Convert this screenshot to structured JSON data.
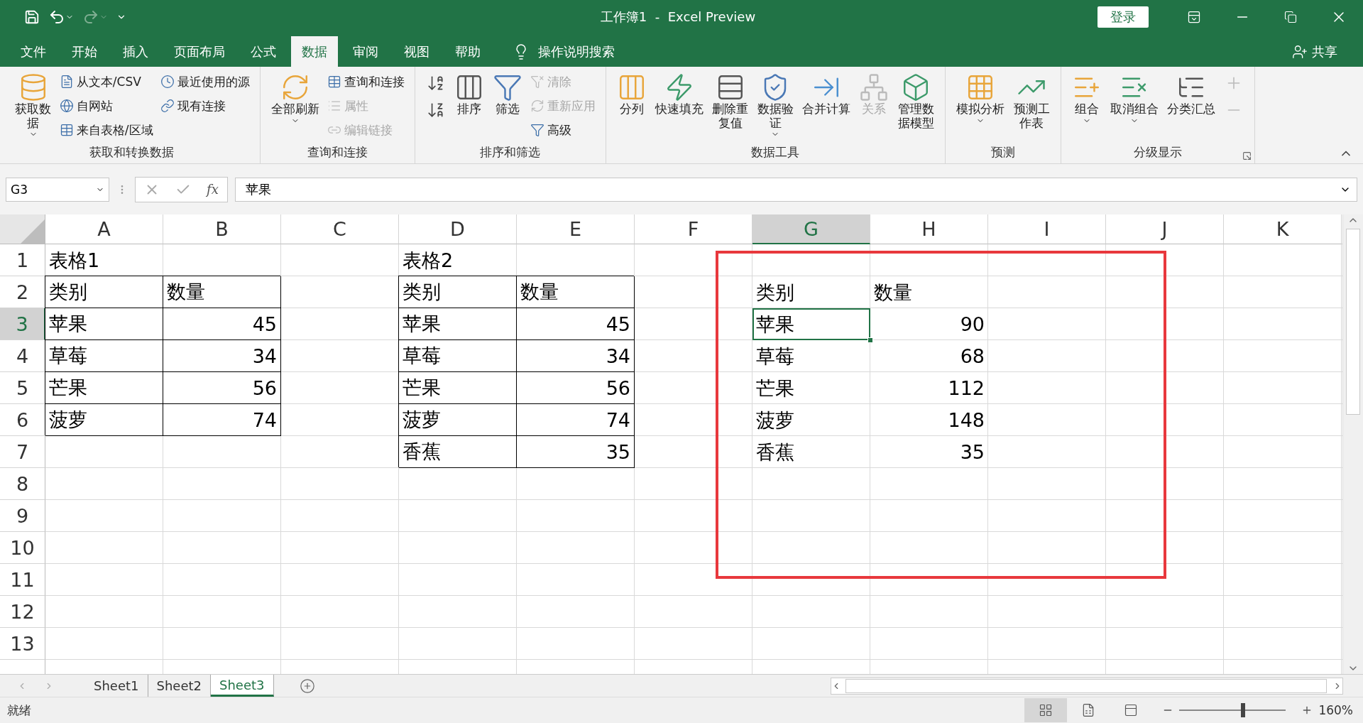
{
  "window": {
    "title": "工作簿1  -  Excel Preview",
    "login": "登录"
  },
  "menu_tabs": [
    {
      "label": "文件",
      "selected": false
    },
    {
      "label": "开始",
      "selected": false
    },
    {
      "label": "插入",
      "selected": false
    },
    {
      "label": "页面布局",
      "selected": false
    },
    {
      "label": "公式",
      "selected": false
    },
    {
      "label": "数据",
      "selected": true
    },
    {
      "label": "审阅",
      "selected": false
    },
    {
      "label": "视图",
      "selected": false
    },
    {
      "label": "帮助",
      "selected": false
    }
  ],
  "tell_me": "操作说明搜索",
  "share": "共享",
  "ribbon": [
    {
      "title": "获取和转换数据",
      "items": [
        {
          "kind": "large",
          "label": "获取数据",
          "dropdown": true,
          "disabled": false
        },
        {
          "kind": "small",
          "label": "从文本/CSV",
          "disabled": false
        },
        {
          "kind": "small",
          "label": "自网站",
          "disabled": false
        },
        {
          "kind": "small",
          "label": "来自表格/区域",
          "disabled": false
        },
        {
          "kind": "small",
          "label": "最近使用的源",
          "disabled": false
        },
        {
          "kind": "small",
          "label": "现有连接",
          "disabled": false
        }
      ]
    },
    {
      "title": "查询和连接",
      "items": [
        {
          "kind": "large",
          "label": "全部刷新",
          "dropdown": true,
          "disabled": false
        },
        {
          "kind": "small",
          "label": "查询和连接",
          "disabled": false
        },
        {
          "kind": "small",
          "label": "属性",
          "disabled": true
        },
        {
          "kind": "small",
          "label": "编辑链接",
          "disabled": true
        }
      ]
    },
    {
      "title": "排序和筛选",
      "items": [
        {
          "kind": "icon",
          "disabled": false
        },
        {
          "kind": "icon",
          "disabled": false
        },
        {
          "kind": "large",
          "label": "排序",
          "dropdown": false,
          "disabled": false
        },
        {
          "kind": "large",
          "label": "筛选",
          "dropdown": false,
          "disabled": false
        },
        {
          "kind": "small",
          "label": "清除",
          "disabled": true
        },
        {
          "kind": "small",
          "label": "重新应用",
          "disabled": true
        },
        {
          "kind": "small",
          "label": "高级",
          "disabled": false
        }
      ]
    },
    {
      "title": "数据工具",
      "items": [
        {
          "kind": "large",
          "label": "分列",
          "dropdown": false,
          "disabled": false
        },
        {
          "kind": "large",
          "label": "快速填充",
          "dropdown": false,
          "disabled": false
        },
        {
          "kind": "large",
          "label": "删除重复值",
          "dropdown": false,
          "disabled": false
        },
        {
          "kind": "large",
          "label": "数据验证",
          "dropdown": true,
          "disabled": false
        },
        {
          "kind": "large",
          "label": "合并计算",
          "dropdown": false,
          "disabled": false
        },
        {
          "kind": "large",
          "label": "关系",
          "dropdown": false,
          "disabled": true
        },
        {
          "kind": "large",
          "label": "管理数据模型",
          "dropdown": false,
          "disabled": false
        }
      ]
    },
    {
      "title": "预测",
      "items": [
        {
          "kind": "large",
          "label": "模拟分析",
          "dropdown": true,
          "disabled": false
        },
        {
          "kind": "large",
          "label": "预测工作表",
          "dropdown": false,
          "disabled": false
        }
      ]
    },
    {
      "title": "分级显示",
      "items": [
        {
          "kind": "large",
          "label": "组合",
          "dropdown": true,
          "disabled": false
        },
        {
          "kind": "large",
          "label": "取消组合",
          "dropdown": true,
          "disabled": false
        },
        {
          "kind": "large",
          "label": "分类汇总",
          "dropdown": false,
          "disabled": false
        },
        {
          "kind": "icon",
          "disabled": true
        },
        {
          "kind": "icon",
          "disabled": true
        }
      ]
    }
  ],
  "formula_bar": {
    "name_box": "G3",
    "function_label": "fx",
    "formula": "苹果"
  },
  "sheet": {
    "columns": [
      {
        "label": "A",
        "selected": false
      },
      {
        "label": "B",
        "selected": false
      },
      {
        "label": "C",
        "selected": false
      },
      {
        "label": "D",
        "selected": false
      },
      {
        "label": "E",
        "selected": false
      },
      {
        "label": "F",
        "selected": false
      },
      {
        "label": "G",
        "selected": true
      },
      {
        "label": "H",
        "selected": false
      },
      {
        "label": "I",
        "selected": false
      },
      {
        "label": "J",
        "selected": false
      },
      {
        "label": "K",
        "selected": false
      }
    ],
    "rows": [
      {
        "label": "1",
        "selected": false
      },
      {
        "label": "2",
        "selected": false
      },
      {
        "label": "3",
        "selected": true
      },
      {
        "label": "4",
        "selected": false
      },
      {
        "label": "5",
        "selected": false
      },
      {
        "label": "6",
        "selected": false
      },
      {
        "label": "7",
        "selected": false
      },
      {
        "label": "8",
        "selected": false
      },
      {
        "label": "9",
        "selected": false
      },
      {
        "label": "10",
        "selected": false
      },
      {
        "label": "11",
        "selected": false
      },
      {
        "label": "12",
        "selected": false
      },
      {
        "label": "13",
        "selected": false
      }
    ],
    "tables": [
      {
        "title": "表格1",
        "bordered": true,
        "header": [
          "类别",
          "数量"
        ],
        "rows": [
          {
            "cells": [
              {
                "text": "苹果",
                "selected": false
              },
              {
                "text": "45",
                "selected": false
              }
            ]
          },
          {
            "cells": [
              {
                "text": "草莓",
                "selected": false
              },
              {
                "text": "34",
                "selected": false
              }
            ]
          },
          {
            "cells": [
              {
                "text": "芒果",
                "selected": false
              },
              {
                "text": "56",
                "selected": false
              }
            ]
          },
          {
            "cells": [
              {
                "text": "菠萝",
                "selected": false
              },
              {
                "text": "74",
                "selected": false
              }
            ]
          }
        ]
      },
      {
        "title": "表格2",
        "bordered": true,
        "header": [
          "类别",
          "数量"
        ],
        "rows": [
          {
            "cells": [
              {
                "text": "苹果",
                "selected": false
              },
              {
                "text": "45",
                "selected": false
              }
            ]
          },
          {
            "cells": [
              {
                "text": "草莓",
                "selected": false
              },
              {
                "text": "34",
                "selected": false
              }
            ]
          },
          {
            "cells": [
              {
                "text": "芒果",
                "selected": false
              },
              {
                "text": "56",
                "selected": false
              }
            ]
          },
          {
            "cells": [
              {
                "text": "菠萝",
                "selected": false
              },
              {
                "text": "74",
                "selected": false
              }
            ]
          },
          {
            "cells": [
              {
                "text": "香蕉",
                "selected": false
              },
              {
                "text": "35",
                "selected": false
              }
            ]
          }
        ]
      },
      {
        "bordered": false,
        "header": [
          "类别",
          "数量"
        ],
        "rows": [
          {
            "cells": [
              {
                "text": "苹果",
                "selected": true
              },
              {
                "text": "90",
                "selected": false
              }
            ]
          },
          {
            "cells": [
              {
                "text": "草莓",
                "selected": false
              },
              {
                "text": "68",
                "selected": false
              }
            ]
          },
          {
            "cells": [
              {
                "text": "芒果",
                "selected": false
              },
              {
                "text": "112",
                "selected": false
              }
            ]
          },
          {
            "cells": [
              {
                "text": "菠萝",
                "selected": false
              },
              {
                "text": "148",
                "selected": false
              }
            ]
          },
          {
            "cells": [
              {
                "text": "香蕉",
                "selected": false
              },
              {
                "text": "35",
                "selected": false
              }
            ]
          }
        ]
      }
    ],
    "annotation": {
      "kind": "frame"
    }
  },
  "sheet_tabs": [
    {
      "label": "Sheet1",
      "selected": false
    },
    {
      "label": "Sheet2",
      "selected": false
    },
    {
      "label": "Sheet3",
      "selected": true
    }
  ],
  "status_bar": {
    "status": "就绪",
    "views": [
      {
        "selected": true
      },
      {
        "selected": false
      },
      {
        "selected": false
      }
    ],
    "zoom": {
      "level": 0.6,
      "reading": "160%"
    }
  }
}
